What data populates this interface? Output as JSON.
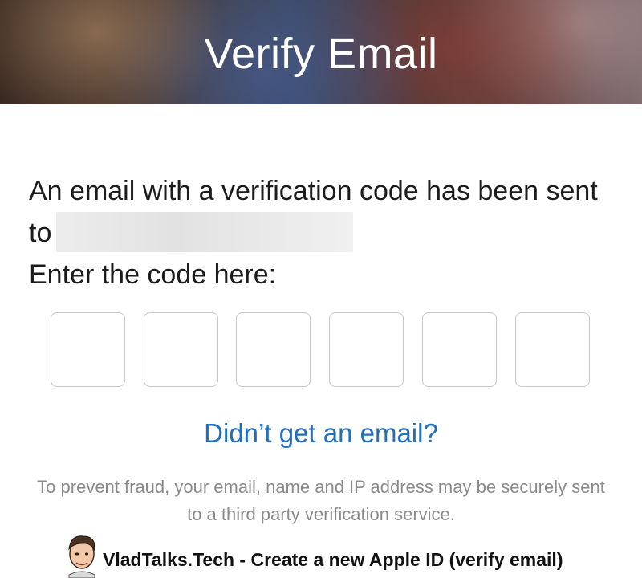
{
  "header": {
    "title": "Verify Email"
  },
  "message": {
    "line_prefix": "An email with a verification code has been sent to",
    "prompt": "Enter the code here:"
  },
  "code_inputs": [
    {
      "value": ""
    },
    {
      "value": ""
    },
    {
      "value": ""
    },
    {
      "value": ""
    },
    {
      "value": ""
    },
    {
      "value": ""
    }
  ],
  "resend_link": "Didn’t get an email?",
  "disclaimer": "To prevent fraud, your email, name and IP address may be securely sent to a third party verification service.",
  "watermark": {
    "text": "VladTalks.Tech - Create a new Apple ID (verify email)"
  },
  "colors": {
    "link": "#1f6fbe",
    "text": "#1c1c1c",
    "muted": "#8a8a8a",
    "box_border": "#c9c9c9"
  }
}
